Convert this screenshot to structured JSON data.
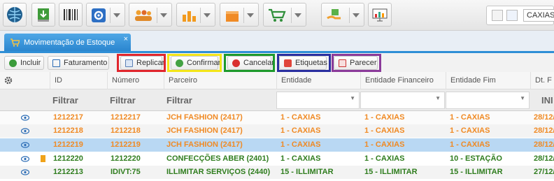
{
  "toolbar": {
    "company": "CAXIAS"
  },
  "tab": {
    "label": "Movimentação de Estoque",
    "close": "×"
  },
  "actions": {
    "incluir": "Incluir",
    "faturamento": "Faturamento",
    "replicar": "Replicar",
    "confirmar": "Confirmar",
    "cancelar": "Cancelar",
    "etiquetas": "Etiquetas",
    "parecer": "Parecer"
  },
  "highlights": {
    "replicar": "#e1262d",
    "confirmar": "#f4e619",
    "cancelar": "#1d9a2c",
    "etiquetas": "#2a2fa0",
    "parecer": "#8b3a9a"
  },
  "grid": {
    "columns": [
      "ID",
      "Número",
      "Parceiro",
      "Entidade",
      "Entidade Financeiro",
      "Entidade Fim",
      "Dt. F"
    ],
    "filters": {
      "id": "Filtrar",
      "numero": "Filtrar",
      "parceiro": "Filtrar",
      "dt": "INI"
    },
    "rows": [
      {
        "id": "1212217",
        "numero": "1212217",
        "parceiro": "JCH FASHION (2417)",
        "entidade": "1 - CAXIAS",
        "financeiro": "1 - CAXIAS",
        "fim": "1 - CAXIAS",
        "dt": "28/12/"
      },
      {
        "id": "1212218",
        "numero": "1212218",
        "parceiro": "JCH FASHION (2417)",
        "entidade": "1 - CAXIAS",
        "financeiro": "1 - CAXIAS",
        "fim": "1 - CAXIAS",
        "dt": "28/12/"
      },
      {
        "id": "1212219",
        "numero": "1212219",
        "parceiro": "JCH FASHION (2417)",
        "entidade": "1 - CAXIAS",
        "financeiro": "1 - CAXIAS",
        "fim": "1 - CAXIAS",
        "dt": "28/12/"
      },
      {
        "id": "1212220",
        "numero": "1212220",
        "parceiro": "CONFECÇÕES ABER (2401)",
        "entidade": "1 - CAXIAS",
        "financeiro": "1 - CAXIAS",
        "fim": "10 - ESTAÇÃO",
        "dt": "28/12/"
      },
      {
        "id": "1212213",
        "numero": "IDIVT:75",
        "parceiro": "ILLIMITAR SERVIÇOS (2440)",
        "entidade": "15 - ILLIMITAR",
        "financeiro": "15 - ILLIMITAR",
        "fim": "15 - ILLIMITAR",
        "dt": "27/12/"
      }
    ]
  }
}
